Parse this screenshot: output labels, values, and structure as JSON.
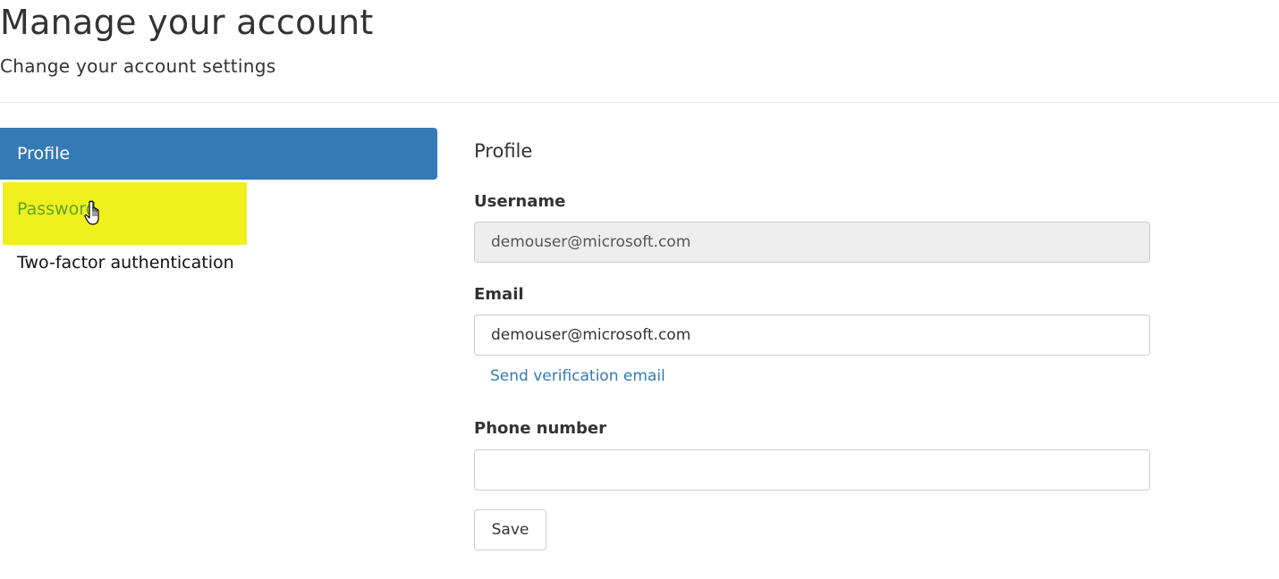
{
  "header": {
    "title": "Manage your account",
    "subtitle": "Change your account settings"
  },
  "nav": {
    "items": [
      {
        "label": "Profile",
        "state": "active"
      },
      {
        "label": "Password",
        "state": "hover"
      },
      {
        "label": "Two-factor authentication",
        "state": "normal"
      }
    ]
  },
  "profile": {
    "section_title": "Profile",
    "username": {
      "label": "Username",
      "value": "demouser@microsoft.com"
    },
    "email": {
      "label": "Email",
      "value": "demouser@microsoft.com",
      "verify_link": "Send verification email"
    },
    "phone": {
      "label": "Phone number",
      "value": ""
    },
    "save_label": "Save"
  },
  "colors": {
    "accent": "#337ab7",
    "highlight": "#f0f01f",
    "hover_text": "#5ca623"
  },
  "icons": {
    "cursor": "hand-pointer-icon"
  }
}
